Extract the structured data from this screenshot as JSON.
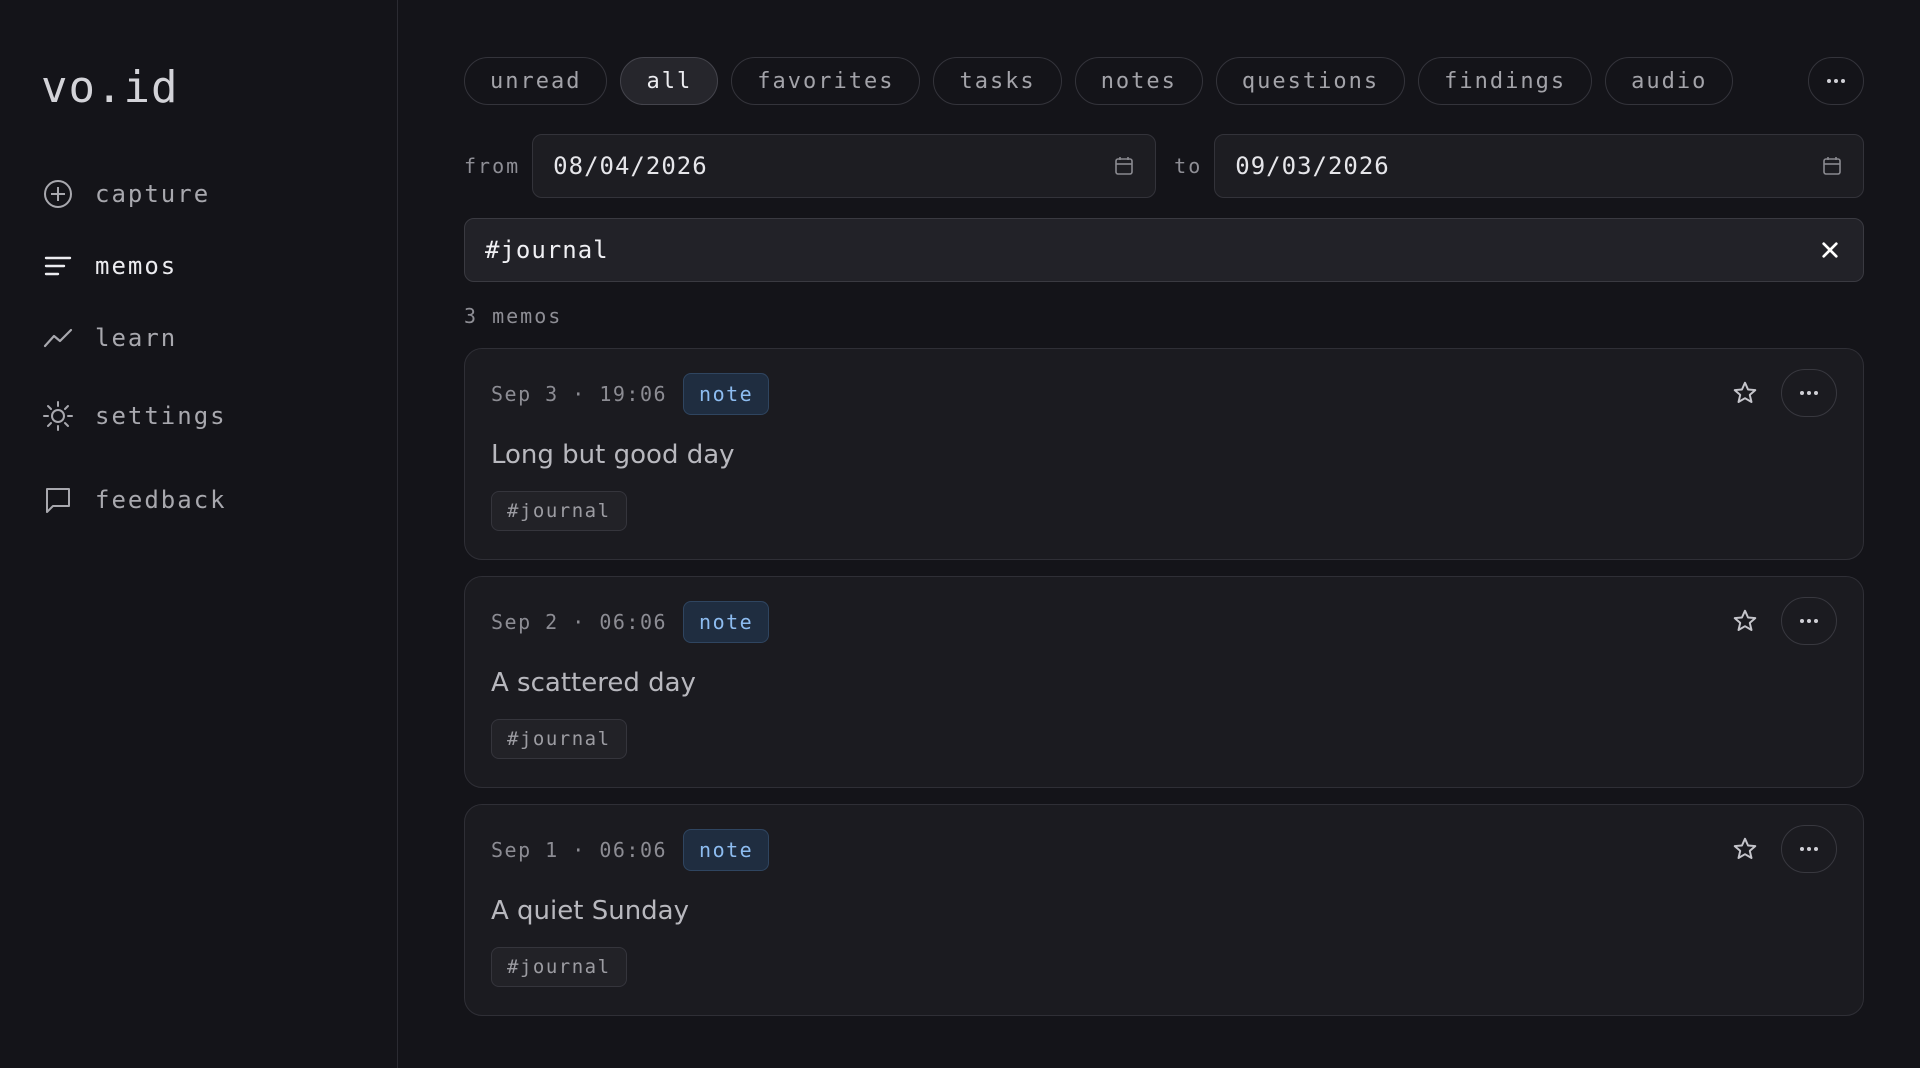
{
  "app": {
    "logo": "vo.id"
  },
  "sidebar": {
    "items": [
      {
        "label": "capture",
        "icon": "plus-circle-icon"
      },
      {
        "label": "memos",
        "icon": "lines-icon",
        "active": true
      },
      {
        "label": "learn",
        "icon": "trend-icon"
      },
      {
        "label": "settings",
        "icon": "gear-icon"
      },
      {
        "label": "feedback",
        "icon": "chat-icon"
      }
    ]
  },
  "filters": {
    "chips": [
      "unread",
      "all",
      "favorites",
      "tasks",
      "notes",
      "questions",
      "findings",
      "audio"
    ],
    "active": "all"
  },
  "dates": {
    "from_label": "from",
    "from_value": "08/04/2026",
    "to_label": "to",
    "to_value": "09/03/2026"
  },
  "search": {
    "value": "#journal"
  },
  "results": {
    "count_text": "3 memos"
  },
  "memos": [
    {
      "date": "Sep 3 · 19:06",
      "type": "note",
      "title": "Long but good day",
      "tag": "#journal"
    },
    {
      "date": "Sep 2 · 06:06",
      "type": "note",
      "title": "A scattered day",
      "tag": "#journal"
    },
    {
      "date": "Sep 1 · 06:06",
      "type": "note",
      "title": "A quiet Sunday",
      "tag": "#journal"
    }
  ],
  "colors": {
    "background": "#141419",
    "card": "#1b1b20",
    "badge_text": "#8dbcf0",
    "badge_bg": "#1f2d40"
  }
}
